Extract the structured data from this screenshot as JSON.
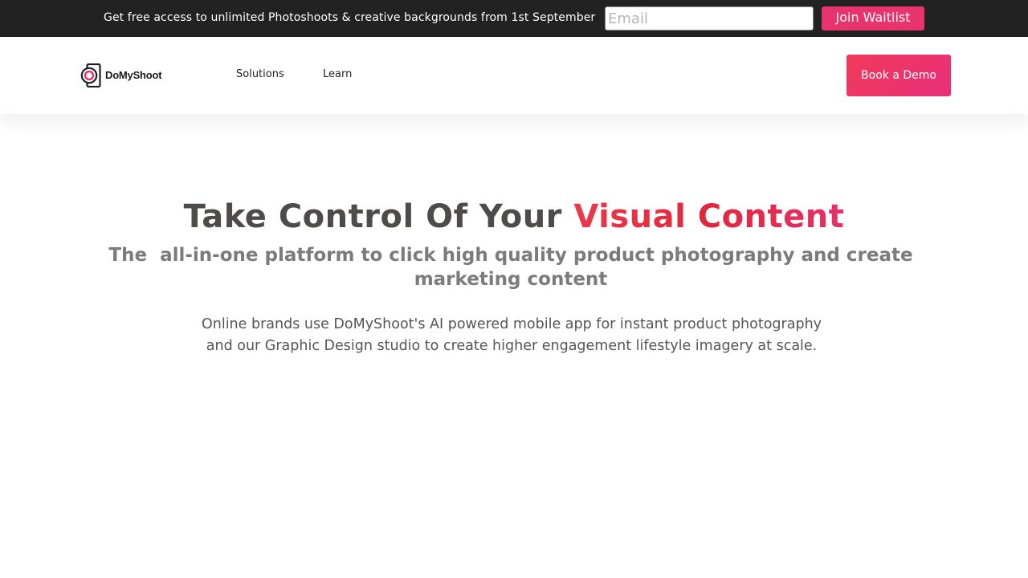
{
  "announcement": {
    "text": "Get free access to unlimited Photoshoots & creative backgrounds from 1st September",
    "email_placeholder": "Email",
    "email_value": "",
    "join_label": "Join Waitlist"
  },
  "header": {
    "logo_text": "DoMyShoot",
    "nav": [
      {
        "label": "Solutions"
      },
      {
        "label": "Learn"
      }
    ],
    "cta_label": "Book a Demo"
  },
  "hero": {
    "title_plain": "Take Control Of Your ",
    "title_accent": "Visual Content",
    "subtitle": "The  all-in-one platform to click high quality product photography and create marketing content",
    "body_line1": "Online brands use DoMyShoot's AI powered mobile app for instant product photography",
    "body_line2": "and our Graphic Design studio to create higher engagement lifestyle imagery at scale."
  },
  "colors": {
    "topbar_bg": "#222222",
    "brand_pink": "#e8336e",
    "accent_red": "#e3263b",
    "title_gray": "#4f4b4b",
    "subtitle_gray": "#7b7b7b",
    "body_gray": "#555555"
  },
  "icons": {
    "logo": "domyshoot-camera-logo-icon"
  }
}
